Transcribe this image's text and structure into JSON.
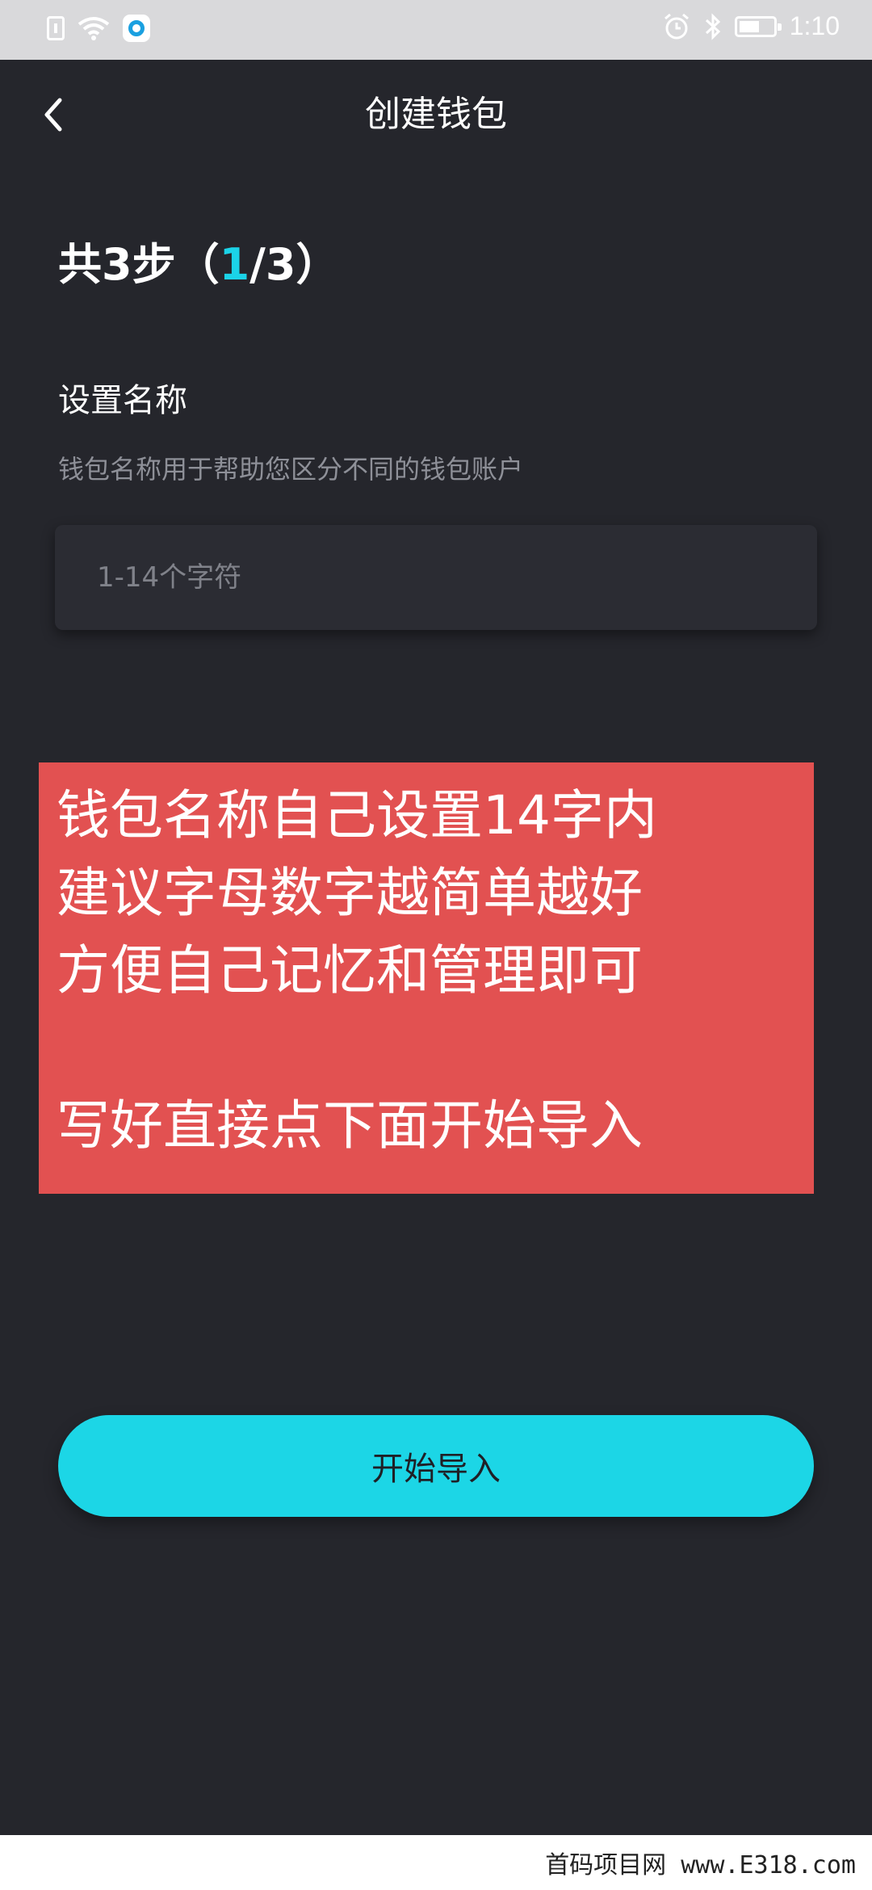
{
  "status_bar": {
    "time": "1:10",
    "icons": [
      "sim-icon",
      "wifi-icon",
      "app-notification-icon",
      "alarm-icon",
      "bluetooth-icon",
      "battery-icon"
    ]
  },
  "nav": {
    "title": "创建钱包",
    "back_icon": "chevron-left-icon"
  },
  "steps": {
    "prefix": "共3步（",
    "current": "1",
    "suffix": "/3）"
  },
  "name_section": {
    "label": "设置名称",
    "hint": "钱包名称用于帮助您区分不同的钱包账户",
    "input_placeholder": "1-14个字符",
    "input_value": ""
  },
  "annotation": {
    "background": "#e25151",
    "lines": [
      "钱包名称自己设置14字内",
      "建议字母数字越简单越好",
      "方便自己记忆和管理即可",
      "",
      "写好直接点下面开始导入"
    ]
  },
  "primary_button": {
    "label": "开始导入",
    "color": "#1cd6e6"
  },
  "watermark": {
    "text": "首码项目网 www.E318.com"
  },
  "colors": {
    "background": "#25262c",
    "accent": "#1bd3e8",
    "hint_text": "#8e9098"
  }
}
